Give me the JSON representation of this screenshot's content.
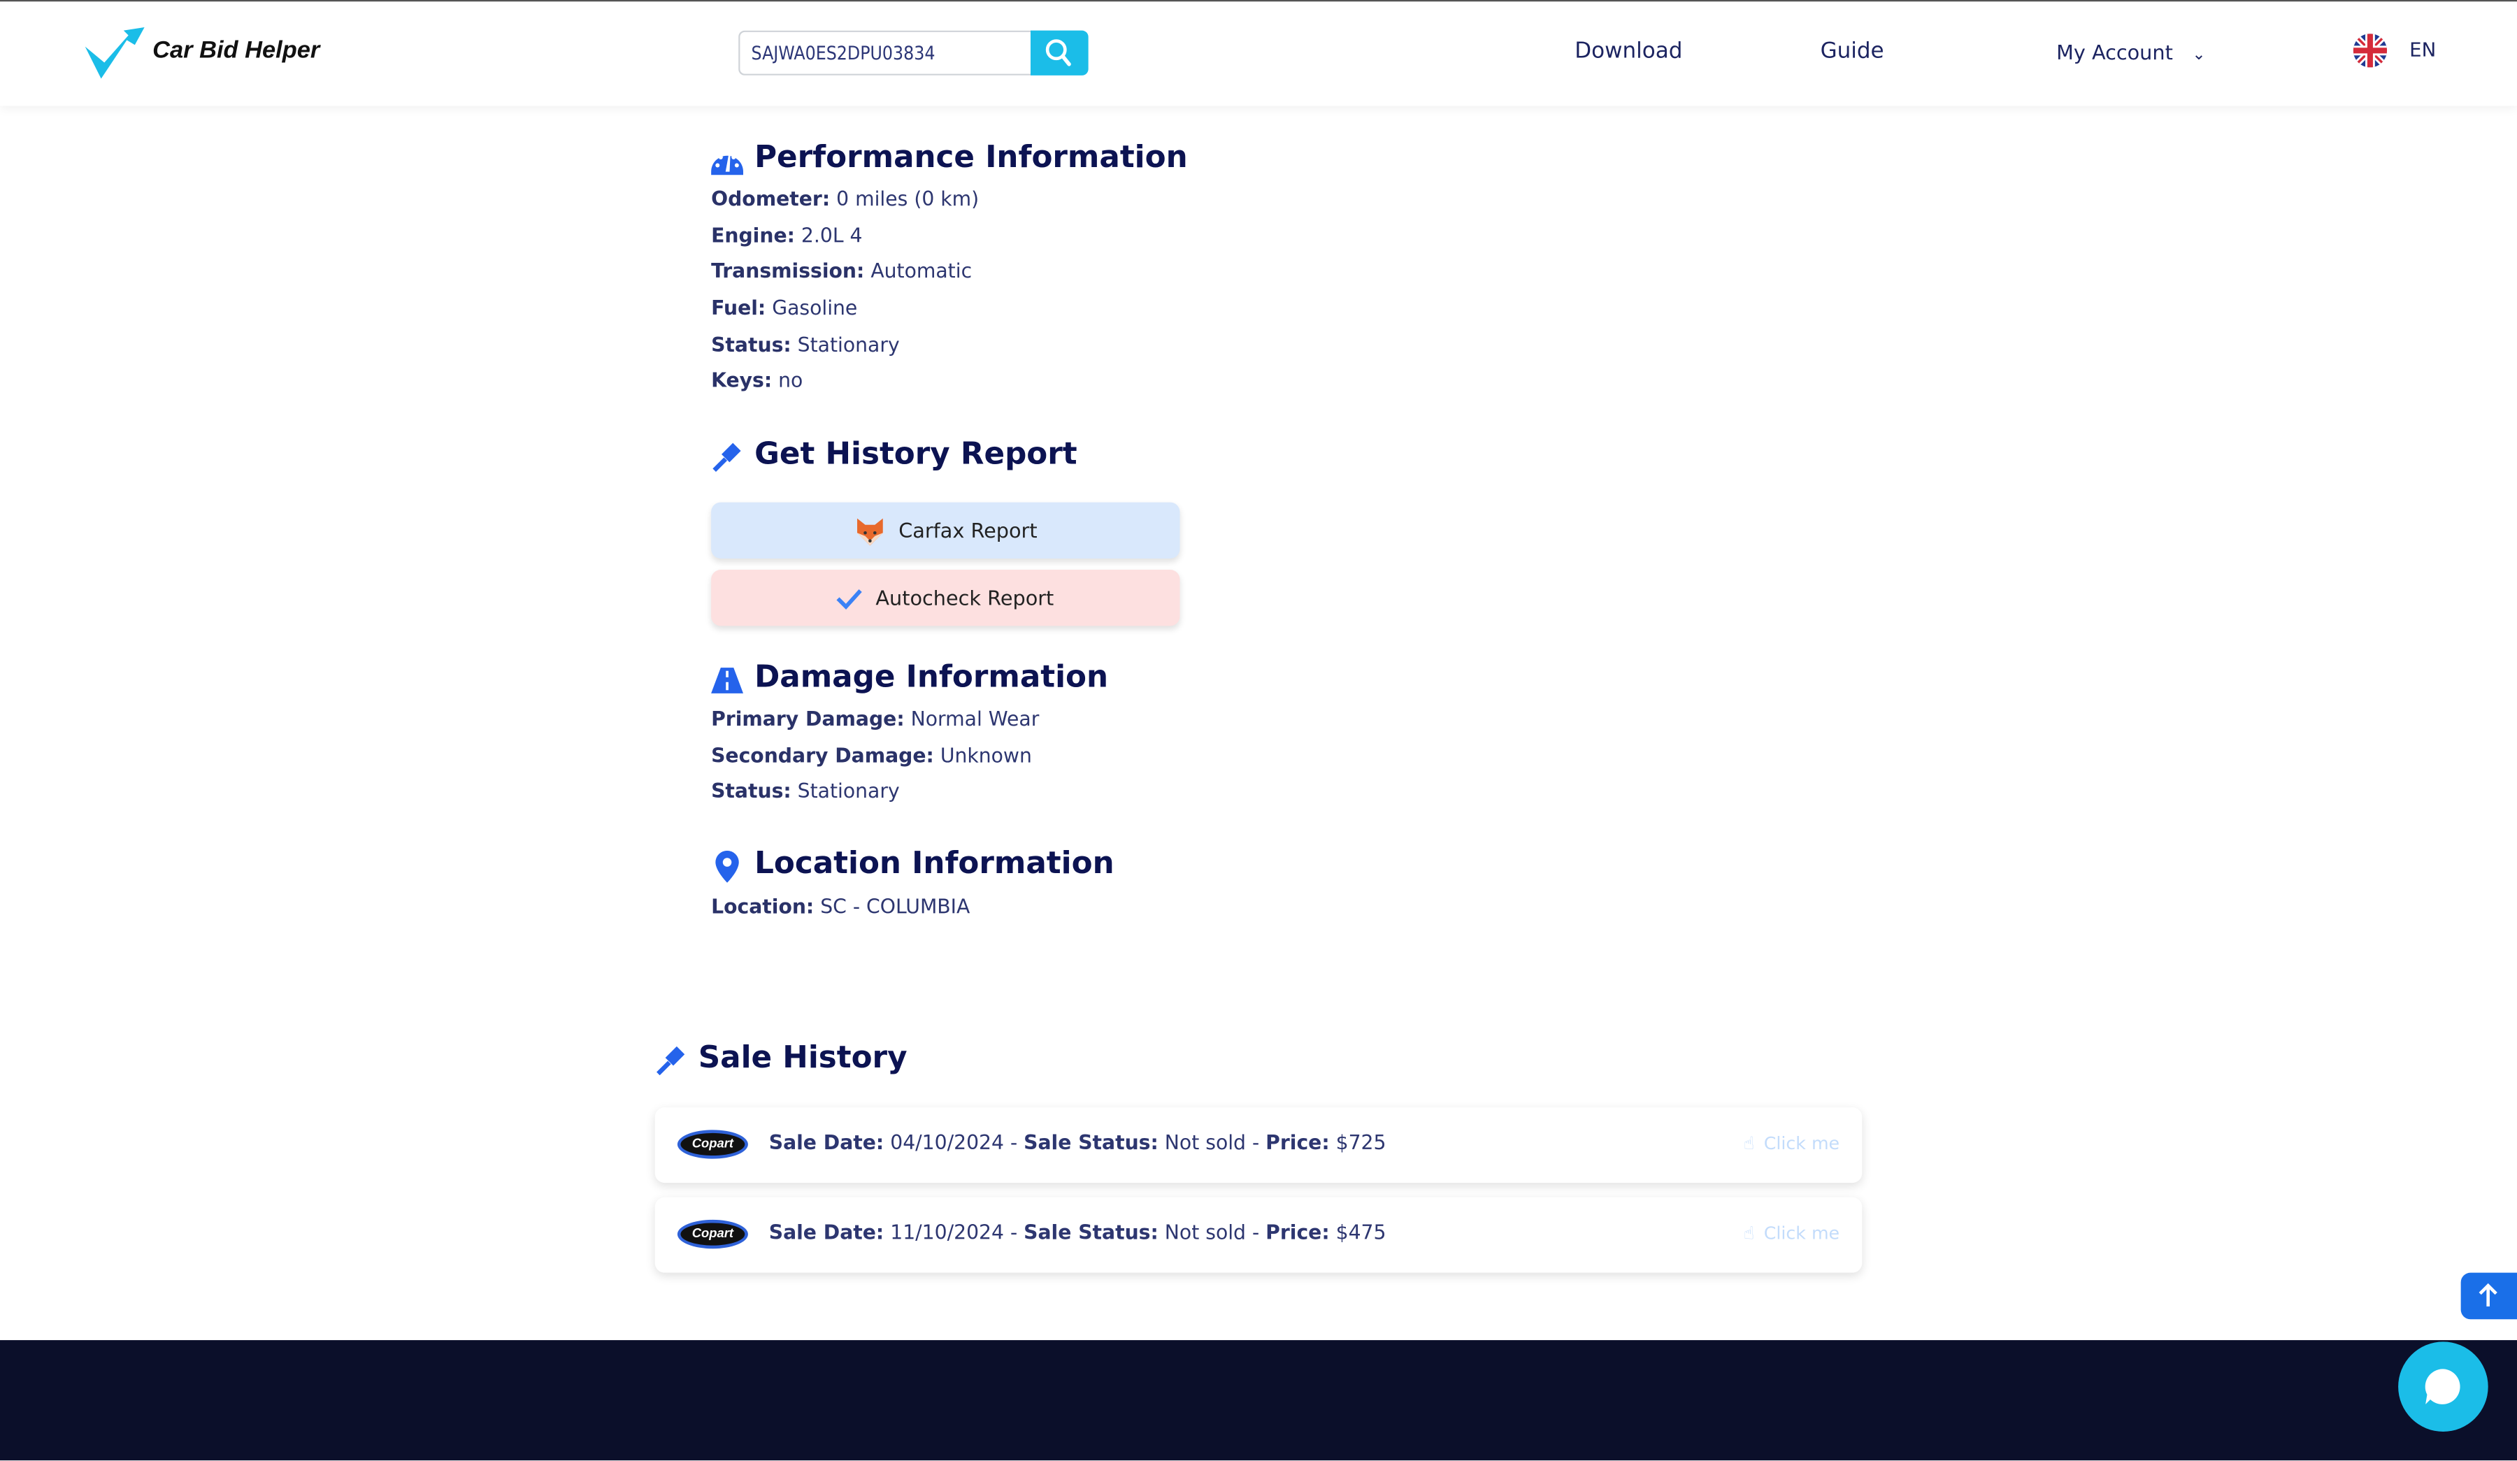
{
  "header": {
    "logo_text": "Car Bid Helper",
    "search_value": "SAJWA0ES2DPU03834",
    "nav": {
      "download": "Download",
      "guide": "Guide",
      "account": "My Account"
    },
    "language": "EN"
  },
  "performance": {
    "title": "Performance Information",
    "rows": [
      {
        "label": "Odometer:",
        "value": "0 miles (0 km)"
      },
      {
        "label": "Engine:",
        "value": "2.0L 4"
      },
      {
        "label": "Transmission:",
        "value": "Automatic"
      },
      {
        "label": "Fuel:",
        "value": "Gasoline"
      },
      {
        "label": "Status:",
        "value": "Stationary"
      },
      {
        "label": "Keys:",
        "value": "no"
      }
    ]
  },
  "history_report": {
    "title": "Get History Report",
    "carfax": "Carfax Report",
    "autocheck": "Autocheck Report"
  },
  "damage": {
    "title": "Damage Information",
    "rows": [
      {
        "label": "Primary Damage:",
        "value": "Normal Wear"
      },
      {
        "label": "Secondary Damage:",
        "value": "Unknown"
      },
      {
        "label": "Status:",
        "value": "Stationary"
      }
    ]
  },
  "location": {
    "title": "Location Information",
    "rows": [
      {
        "label": "Location:",
        "value": "SC - COLUMBIA"
      }
    ]
  },
  "sale_history": {
    "title": "Sale History",
    "labels": {
      "date": "Sale Date:",
      "status": "Sale Status:",
      "price": "Price:",
      "sep": " - "
    },
    "click_label": "Click me",
    "logo_text": "Copart",
    "items": [
      {
        "date": "04/10/2024",
        "status": "Not sold",
        "price": "$725"
      },
      {
        "date": "11/10/2024",
        "status": "Not sold",
        "price": "$475"
      }
    ]
  },
  "colors": {
    "accent": "#1bbde8",
    "navy": "#0c1352",
    "icon_blue": "#2563eb",
    "footer": "#0b0f2a"
  }
}
